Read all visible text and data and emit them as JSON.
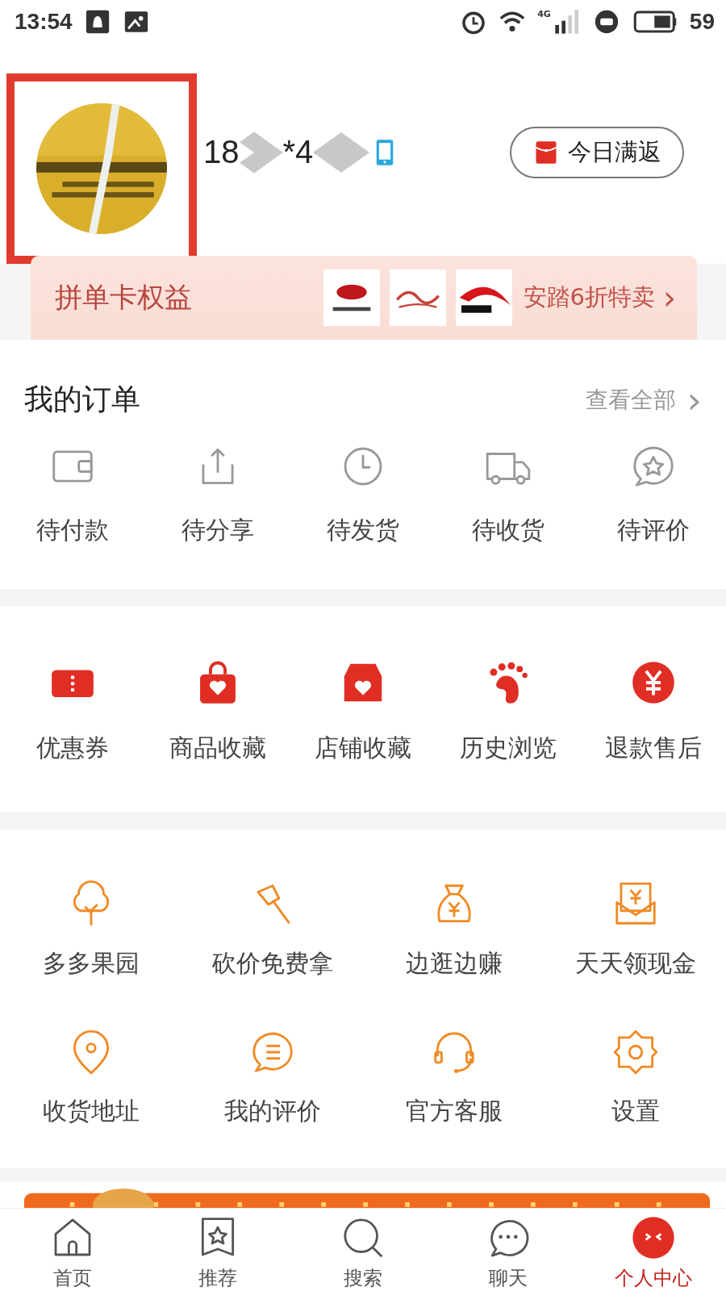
{
  "status_bar": {
    "time": "13:54",
    "network": "4G",
    "battery": "59"
  },
  "profile": {
    "phone_start": "18",
    "phone_end": "*4",
    "highlighted": true,
    "promo_button": "今日满返"
  },
  "card_banner": {
    "title": "拼单卡权益",
    "promo": "安踏6折特卖",
    "arrow": "›"
  },
  "orders": {
    "title": "我的订单",
    "view_all": "查看全部",
    "arrow": "›",
    "items": [
      {
        "label": "待付款"
      },
      {
        "label": "待分享"
      },
      {
        "label": "待发货"
      },
      {
        "label": "待收货"
      },
      {
        "label": "待评价"
      }
    ]
  },
  "shortcuts": [
    {
      "label": "优惠券"
    },
    {
      "label": "商品收藏"
    },
    {
      "label": "店铺收藏"
    },
    {
      "label": "历史浏览"
    },
    {
      "label": "退款售后"
    }
  ],
  "services": [
    {
      "label": "多多果园"
    },
    {
      "label": "砍价免费拿"
    },
    {
      "label": "边逛边赚"
    },
    {
      "label": "天天领现金"
    },
    {
      "label": "收货地址"
    },
    {
      "label": "我的评价"
    },
    {
      "label": "官方客服"
    },
    {
      "label": "设置"
    }
  ],
  "tab_bar": [
    {
      "label": "首页",
      "selected": false
    },
    {
      "label": "推荐",
      "selected": false
    },
    {
      "label": "搜索",
      "selected": false
    },
    {
      "label": "聊天",
      "selected": false
    },
    {
      "label": "个人中心",
      "selected": true
    }
  ]
}
